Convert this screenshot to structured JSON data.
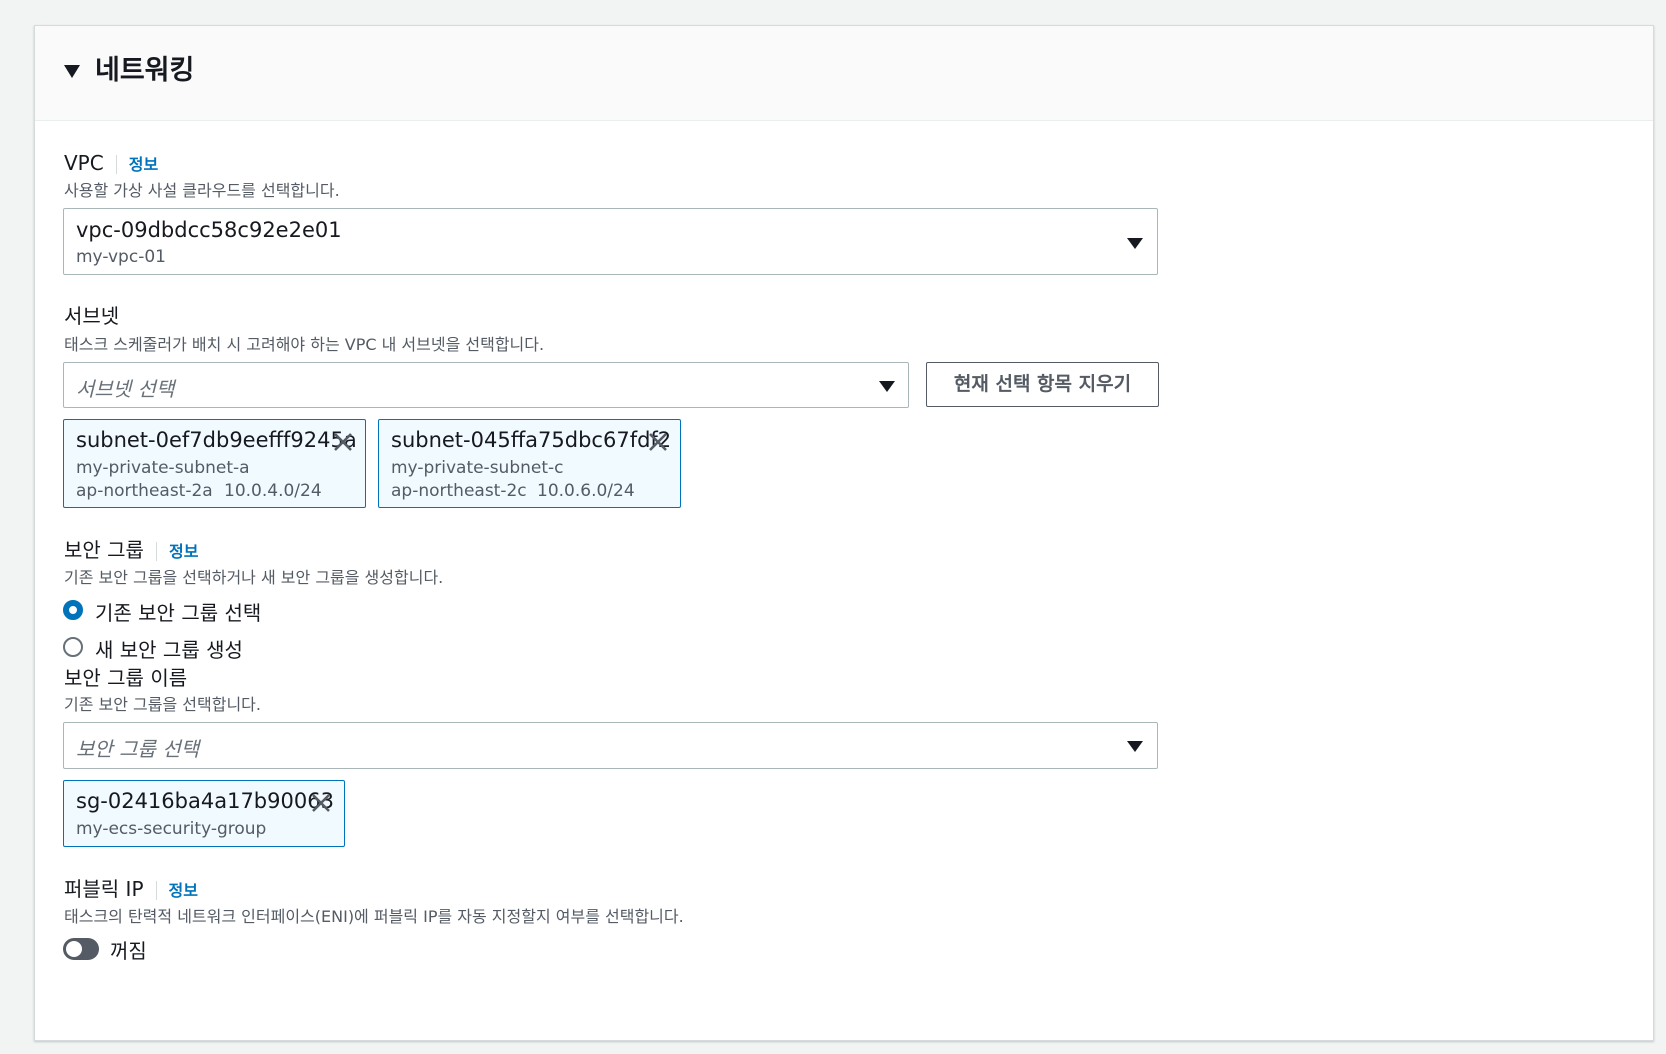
{
  "section": {
    "title": "네트워킹"
  },
  "vpc": {
    "label": "VPC",
    "info": "정보",
    "description": "사용할 가상 사설 클라우드를 선택합니다.",
    "selected_id": "vpc-09dbdcc58c92e2e01",
    "selected_name": "my-vpc-01"
  },
  "subnet": {
    "label": "서브넷",
    "description": "태스크 스케줄러가 배치 시 고려해야 하는 VPC 내 서브넷을 선택합니다.",
    "placeholder": "서브넷 선택",
    "clear_button": "현재 선택 항목 지우기",
    "tokens": [
      {
        "id": "subnet-0ef7db9eefff9245a",
        "name": "my-private-subnet-a",
        "az": "ap-northeast-2a",
        "cidr": "10.0.4.0/24"
      },
      {
        "id": "subnet-045ffa75dbc67fdf2",
        "name": "my-private-subnet-c",
        "az": "ap-northeast-2c",
        "cidr": "10.0.6.0/24"
      }
    ]
  },
  "security_group": {
    "label": "보안 그룹",
    "info": "정보",
    "description": "기존 보안 그룹을 선택하거나 새 보안 그룹을 생성합니다.",
    "options": [
      {
        "label": "기존 보안 그룹 선택",
        "selected": true
      },
      {
        "label": "새 보안 그룹 생성",
        "selected": false
      }
    ],
    "name_label": "보안 그룹 이름",
    "name_description": "기존 보안 그룹을 선택합니다.",
    "placeholder": "보안 그룹 선택",
    "tokens": [
      {
        "id": "sg-02416ba4a17b90063",
        "name": "my-ecs-security-group"
      }
    ]
  },
  "public_ip": {
    "label": "퍼블릭 IP",
    "info": "정보",
    "description": "태스크의 탄력적 네트워크 인터페이스(ENI)에 퍼블릭 IP를 자동 지정할지 여부를 선택합니다.",
    "toggle_label": "꺼짐",
    "enabled": false
  },
  "colors": {
    "accent": "#0073bb",
    "token_bg": "#f1faff",
    "text": "#16191f",
    "muted": "#545b64"
  }
}
